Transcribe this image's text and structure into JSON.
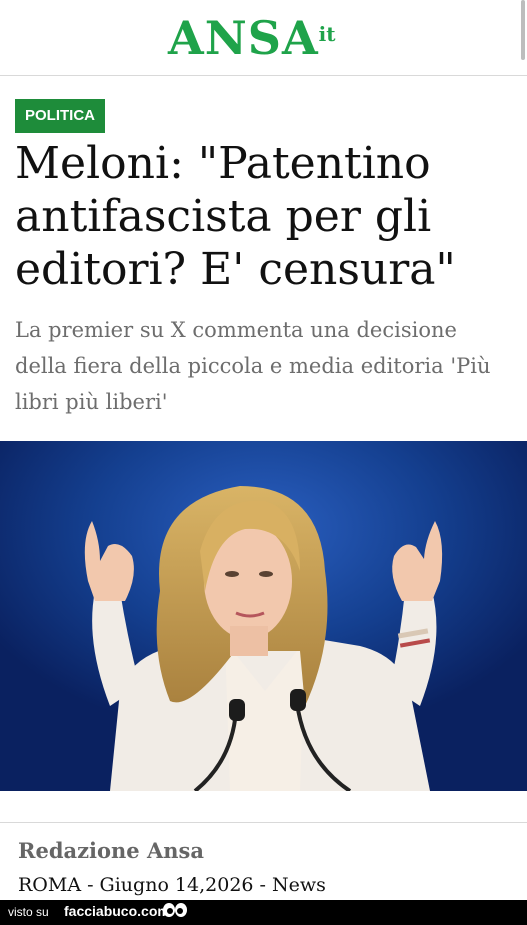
{
  "header": {
    "logo_main": "ANSA",
    "logo_suffix": "it"
  },
  "article": {
    "category": "POLITICA",
    "headline": "Meloni: \"Patentino antifascista per gli editori? E' censura\"",
    "subtitle": "La premier su X commenta una decisione della fiera della piccola e media editoria 'Più libri più liberi'",
    "author": "Redazione Ansa",
    "dateline": "ROMA - Giugno 14,2026 - News"
  },
  "watermark": {
    "prefix": "visto su",
    "site": "facciabuco.com"
  },
  "colors": {
    "brand_green": "#1fa34a",
    "category_bg": "#1e8c3a",
    "photo_bg": "#123a86"
  }
}
